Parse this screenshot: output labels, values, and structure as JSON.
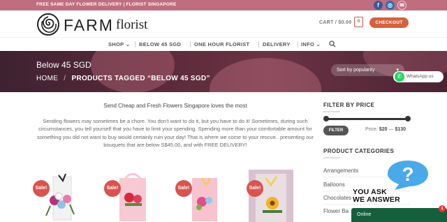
{
  "topbar": {
    "text": "FREE SAME DAY FLOWER DELIVERY | FLORIST SINGAPORE",
    "social": [
      {
        "icon": "facebook-icon",
        "glyph": "f"
      },
      {
        "icon": "instagram-icon",
        "glyph": "◎"
      },
      {
        "icon": "email-icon",
        "glyph": "✉"
      }
    ]
  },
  "header": {
    "logo_word": "FARM",
    "logo_sub": "florist",
    "cart_label": "CART / $0.00",
    "cart_count": "0",
    "checkout_label": "CHECKOUT"
  },
  "nav": {
    "items": [
      {
        "label": "SHOP",
        "caret": "⌄"
      },
      {
        "label": "BELOW 45 SGD"
      },
      {
        "label": "ONE HOUR FLORIST"
      },
      {
        "label": "DELIVERY"
      },
      {
        "label": "INFO",
        "caret": "⌄"
      }
    ],
    "search_icon": "search-icon"
  },
  "hero": {
    "title": "Below 45 SGD",
    "breadcrumb_home": "HOME",
    "breadcrumb_sep": "/",
    "breadcrumb_current": "PRODUCTS TAGGED “BELOW 45 SGD”",
    "sort_value": "Sort by popularity",
    "whatsapp_label": "WhatsApp us"
  },
  "main": {
    "intro_title": "Send Cheap and Fresh Flowers Singapore loves the most",
    "intro_body": "Sending flowers may sometimes be a chore. You don't want to do it, but you have to do it! Sometimes, during such circumstances, you tell yourself that you have to limit your spending. Spending more than your comfortable amount for something you did not want to buy would certainly ruin your day! That is where we come to your rescue.. presenting our bouquets that are below S$45.00, and with FREE DELIVERY!",
    "sale_label": "Sale!",
    "products": [
      {
        "bg": "#ffffff",
        "accent": "#b0357c"
      },
      {
        "bg": "#f7c9d3",
        "accent": "#d62a3a"
      },
      {
        "bg": "#f6c3cf",
        "accent": "#e04f86"
      },
      {
        "bg": "#d8c2cf",
        "accent": "#f1b323"
      }
    ]
  },
  "sidebar": {
    "filter_heading": "FILTER BY PRICE",
    "filter_button": "FILTER",
    "price_label": "Price:",
    "price_min": "$20",
    "price_dash": "—",
    "price_max": "$130",
    "categories_heading": "PRODUCT CATEGORIES",
    "categories": [
      "Arrangements",
      "Balloons",
      "Chocolates",
      "Flower Ba"
    ]
  },
  "chat": {
    "title_line1": "YOU ASK",
    "title_line2": "WE ANSWER",
    "status": "Online",
    "badge": "1"
  },
  "colors": {
    "topbar": "#c06d80",
    "checkout": "#d4613f",
    "sale": "#d9534f",
    "chat_bar": "#155f3c",
    "chat_bubble": "#4aa9e8"
  }
}
